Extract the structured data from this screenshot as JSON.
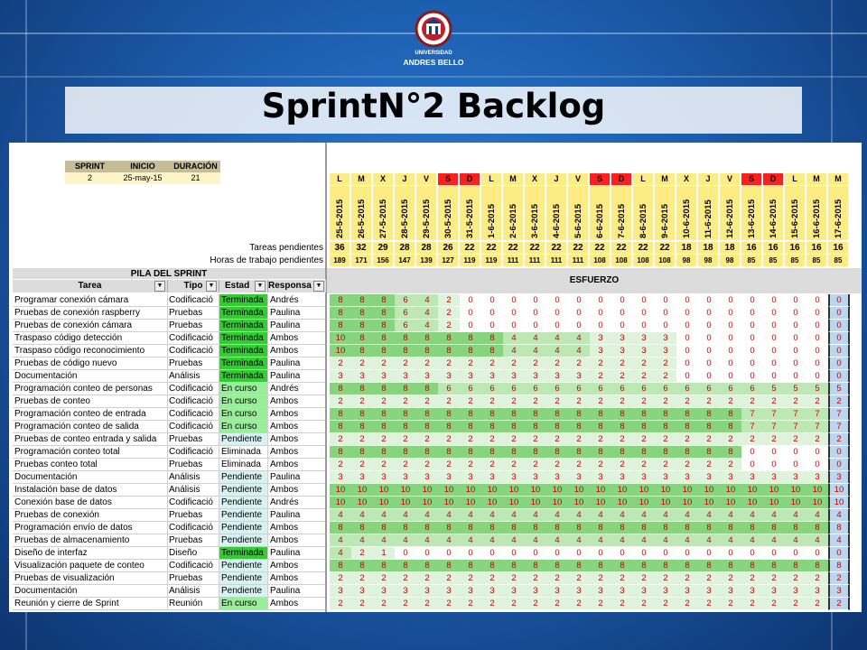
{
  "logo_text": [
    "UNIVERSIDAD",
    "ANDRES BELLO"
  ],
  "title": "SprintN°2 Backlog",
  "sprint_info": {
    "headers": [
      "SPRINT",
      "INICIO",
      "DURACIÓN"
    ],
    "values": [
      "2",
      "25-may-15",
      "21"
    ]
  },
  "days": [
    "L",
    "M",
    "X",
    "J",
    "V",
    "S",
    "D",
    "L",
    "M",
    "X",
    "J",
    "V",
    "S",
    "D",
    "L",
    "M",
    "X",
    "J",
    "V",
    "S",
    "D",
    "L",
    "M",
    "M"
  ],
  "weekend_indices": [
    5,
    6,
    12,
    13,
    19,
    20
  ],
  "dates": [
    "25-5-2015",
    "26-5-2015",
    "27-5-2015",
    "28-5-2015",
    "29-5-2015",
    "30-5-2015",
    "31-5-2015",
    "1-6-2015",
    "2-6-2015",
    "3-6-2015",
    "4-6-2015",
    "5-6-2015",
    "6-6-2015",
    "7-6-2015",
    "8-6-2015",
    "9-6-2015",
    "10-6-2015",
    "11-6-2015",
    "12-6-2015",
    "13-6-2015",
    "14-6-2015",
    "15-6-2015",
    "16-6-2015",
    "17-6-2015"
  ],
  "tareas_pendientes_label": "Tareas pendientes",
  "horas_label": "Horas de trabajo pendientes",
  "tareas_pendientes": [
    36,
    32,
    29,
    28,
    28,
    26,
    22,
    22,
    22,
    22,
    22,
    22,
    22,
    22,
    22,
    22,
    18,
    18,
    18,
    16,
    16,
    16,
    16,
    16
  ],
  "horas_pendientes": [
    189,
    171,
    156,
    147,
    139,
    127,
    119,
    119,
    111,
    111,
    111,
    111,
    108,
    108,
    108,
    108,
    98,
    98,
    98,
    85,
    85,
    85,
    85,
    85
  ],
  "pila_label": "PILA DEL SPRINT",
  "esfuerzo_label": "ESFUERZO",
  "columns": {
    "tarea": "Tarea",
    "tipo": "Tipo",
    "estado": "Estad",
    "responsable": "Responsa"
  },
  "status_colors": {
    "Terminada": "#33cc33",
    "En curso": "#99ee99",
    "Pendiente": "#d8f2f4",
    "Eliminada": "#ffffff"
  },
  "tasks": [
    {
      "tarea": "Programar conexión cámara",
      "tipo": "Codificació",
      "estado": "Terminada",
      "responsable": "Andrés",
      "effort": [
        8,
        8,
        8,
        6,
        4,
        2,
        0,
        0,
        0,
        0,
        0,
        0,
        0,
        0,
        0,
        0,
        0,
        0,
        0,
        0,
        0,
        0,
        0,
        0
      ]
    },
    {
      "tarea": "Pruebas de conexión raspberry",
      "tipo": "Pruebas",
      "estado": "Terminada",
      "responsable": "Paulina",
      "effort": [
        8,
        8,
        8,
        6,
        4,
        2,
        0,
        0,
        0,
        0,
        0,
        0,
        0,
        0,
        0,
        0,
        0,
        0,
        0,
        0,
        0,
        0,
        0,
        0
      ]
    },
    {
      "tarea": "Pruebas de conexión cámara",
      "tipo": "Pruebas",
      "estado": "Terminada",
      "responsable": "Paulina",
      "effort": [
        8,
        8,
        8,
        6,
        4,
        2,
        0,
        0,
        0,
        0,
        0,
        0,
        0,
        0,
        0,
        0,
        0,
        0,
        0,
        0,
        0,
        0,
        0,
        0
      ]
    },
    {
      "tarea": "Traspaso código detección",
      "tipo": "Codificació",
      "estado": "Terminada",
      "responsable": "Ambos",
      "effort": [
        10,
        8,
        8,
        8,
        8,
        8,
        8,
        8,
        4,
        4,
        4,
        4,
        3,
        3,
        3,
        3,
        0,
        0,
        0,
        0,
        0,
        0,
        0,
        0
      ]
    },
    {
      "tarea": "Traspaso código reconocimiento",
      "tipo": "Codificació",
      "estado": "Terminada",
      "responsable": "Ambos",
      "effort": [
        10,
        8,
        8,
        8,
        8,
        8,
        8,
        8,
        4,
        4,
        4,
        4,
        3,
        3,
        3,
        3,
        0,
        0,
        0,
        0,
        0,
        0,
        0,
        0
      ]
    },
    {
      "tarea": "Pruebas de código nuevo",
      "tipo": "Pruebas",
      "estado": "Terminada",
      "responsable": "Paulina",
      "effort": [
        2,
        2,
        2,
        2,
        2,
        2,
        2,
        2,
        2,
        2,
        2,
        2,
        2,
        2,
        2,
        2,
        0,
        0,
        0,
        0,
        0,
        0,
        0,
        0
      ]
    },
    {
      "tarea": "Documentación",
      "tipo": "Análisis",
      "estado": "Terminada",
      "responsable": "Paulina",
      "effort": [
        3,
        3,
        3,
        3,
        3,
        3,
        3,
        3,
        3,
        3,
        3,
        3,
        2,
        2,
        2,
        2,
        0,
        0,
        0,
        0,
        0,
        0,
        0,
        0
      ]
    },
    {
      "tarea": "Programación conteo de personas",
      "tipo": "Codificació",
      "estado": "En curso",
      "responsable": "Andrés",
      "effort": [
        8,
        8,
        8,
        8,
        8,
        6,
        6,
        6,
        6,
        6,
        6,
        6,
        6,
        6,
        6,
        6,
        6,
        6,
        6,
        6,
        5,
        5,
        5,
        5
      ]
    },
    {
      "tarea": "Pruebas de conteo",
      "tipo": "Codificació",
      "estado": "En curso",
      "responsable": "Ambos",
      "effort": [
        2,
        2,
        2,
        2,
        2,
        2,
        2,
        2,
        2,
        2,
        2,
        2,
        2,
        2,
        2,
        2,
        2,
        2,
        2,
        2,
        2,
        2,
        2,
        2
      ]
    },
    {
      "tarea": "Programación conteo de entrada",
      "tipo": "Codificació",
      "estado": "En curso",
      "responsable": "Ambos",
      "effort": [
        8,
        8,
        8,
        8,
        8,
        8,
        8,
        8,
        8,
        8,
        8,
        8,
        8,
        8,
        8,
        8,
        8,
        8,
        8,
        7,
        7,
        7,
        7,
        7
      ]
    },
    {
      "tarea": "Programación conteo de salida",
      "tipo": "Codificació",
      "estado": "En curso",
      "responsable": "Ambos",
      "effort": [
        8,
        8,
        8,
        8,
        8,
        8,
        8,
        8,
        8,
        8,
        8,
        8,
        8,
        8,
        8,
        8,
        8,
        8,
        8,
        7,
        7,
        7,
        7,
        7
      ]
    },
    {
      "tarea": "Pruebas de conteo entrada y salida",
      "tipo": "Pruebas",
      "estado": "Pendiente",
      "responsable": "Ambos",
      "effort": [
        2,
        2,
        2,
        2,
        2,
        2,
        2,
        2,
        2,
        2,
        2,
        2,
        2,
        2,
        2,
        2,
        2,
        2,
        2,
        2,
        2,
        2,
        2,
        2
      ]
    },
    {
      "tarea": "Programación conteo total",
      "tipo": "Codificació",
      "estado": "Eliminada",
      "responsable": "Ambos",
      "effort": [
        8,
        8,
        8,
        8,
        8,
        8,
        8,
        8,
        8,
        8,
        8,
        8,
        8,
        8,
        8,
        8,
        8,
        8,
        8,
        0,
        0,
        0,
        0,
        0
      ]
    },
    {
      "tarea": "Pruebas conteo total",
      "tipo": "Pruebas",
      "estado": "Eliminada",
      "responsable": "Ambos",
      "effort": [
        2,
        2,
        2,
        2,
        2,
        2,
        2,
        2,
        2,
        2,
        2,
        2,
        2,
        2,
        2,
        2,
        2,
        2,
        2,
        0,
        0,
        0,
        0,
        0
      ]
    },
    {
      "tarea": "Documentación",
      "tipo": "Análisis",
      "estado": "Pendiente",
      "responsable": "Paulina",
      "effort": [
        3,
        3,
        3,
        3,
        3,
        3,
        3,
        3,
        3,
        3,
        3,
        3,
        3,
        3,
        3,
        3,
        3,
        3,
        3,
        3,
        3,
        3,
        3,
        3
      ]
    },
    {
      "tarea": "Instalación base de datos",
      "tipo": "Análisis",
      "estado": "Pendiente",
      "responsable": "Ambos",
      "effort": [
        10,
        10,
        10,
        10,
        10,
        10,
        10,
        10,
        10,
        10,
        10,
        10,
        10,
        10,
        10,
        10,
        10,
        10,
        10,
        10,
        10,
        10,
        10,
        10
      ]
    },
    {
      "tarea": "Conexión base de datos",
      "tipo": "Codificació",
      "estado": "Pendiente",
      "responsable": "Andrés",
      "effort": [
        10,
        10,
        10,
        10,
        10,
        10,
        10,
        10,
        10,
        10,
        10,
        10,
        10,
        10,
        10,
        10,
        10,
        10,
        10,
        10,
        10,
        10,
        10,
        10
      ]
    },
    {
      "tarea": "Pruebas de conexión",
      "tipo": "Pruebas",
      "estado": "Pendiente",
      "responsable": "Paulina",
      "effort": [
        4,
        4,
        4,
        4,
        4,
        4,
        4,
        4,
        4,
        4,
        4,
        4,
        4,
        4,
        4,
        4,
        4,
        4,
        4,
        4,
        4,
        4,
        4,
        4
      ]
    },
    {
      "tarea": "Programación envío de datos",
      "tipo": "Codificació",
      "estado": "Pendiente",
      "responsable": "Ambos",
      "effort": [
        8,
        8,
        8,
        8,
        8,
        8,
        8,
        8,
        8,
        8,
        8,
        8,
        8,
        8,
        8,
        8,
        8,
        8,
        8,
        8,
        8,
        8,
        8,
        8
      ]
    },
    {
      "tarea": "Pruebas de almacenamiento",
      "tipo": "Pruebas",
      "estado": "Pendiente",
      "responsable": "Ambos",
      "effort": [
        4,
        4,
        4,
        4,
        4,
        4,
        4,
        4,
        4,
        4,
        4,
        4,
        4,
        4,
        4,
        4,
        4,
        4,
        4,
        4,
        4,
        4,
        4,
        4
      ]
    },
    {
      "tarea": "Diseño de interfaz",
      "tipo": "Diseño",
      "estado": "Terminada",
      "responsable": "Paulina",
      "effort": [
        4,
        2,
        1,
        0,
        0,
        0,
        0,
        0,
        0,
        0,
        0,
        0,
        0,
        0,
        0,
        0,
        0,
        0,
        0,
        0,
        0,
        0,
        0,
        0
      ]
    },
    {
      "tarea": "Visualización paquete de conteo",
      "tipo": "Codificació",
      "estado": "Pendiente",
      "responsable": "Ambos",
      "effort": [
        8,
        8,
        8,
        8,
        8,
        8,
        8,
        8,
        8,
        8,
        8,
        8,
        8,
        8,
        8,
        8,
        8,
        8,
        8,
        8,
        8,
        8,
        8,
        8
      ]
    },
    {
      "tarea": "Pruebas de visualización",
      "tipo": "Pruebas",
      "estado": "Pendiente",
      "responsable": "Ambos",
      "effort": [
        2,
        2,
        2,
        2,
        2,
        2,
        2,
        2,
        2,
        2,
        2,
        2,
        2,
        2,
        2,
        2,
        2,
        2,
        2,
        2,
        2,
        2,
        2,
        2
      ]
    },
    {
      "tarea": "Documentación",
      "tipo": "Análisis",
      "estado": "Pendiente",
      "responsable": "Paulina",
      "effort": [
        3,
        3,
        3,
        3,
        3,
        3,
        3,
        3,
        3,
        3,
        3,
        3,
        3,
        3,
        3,
        3,
        3,
        3,
        3,
        3,
        3,
        3,
        3,
        3
      ]
    },
    {
      "tarea": "Reunión y cierre de Sprint",
      "tipo": "Reunión",
      "estado": "En curso",
      "responsable": "Ambos",
      "effort": [
        2,
        2,
        2,
        2,
        2,
        2,
        2,
        2,
        2,
        2,
        2,
        2,
        2,
        2,
        2,
        2,
        2,
        2,
        2,
        2,
        2,
        2,
        2,
        2
      ]
    }
  ]
}
